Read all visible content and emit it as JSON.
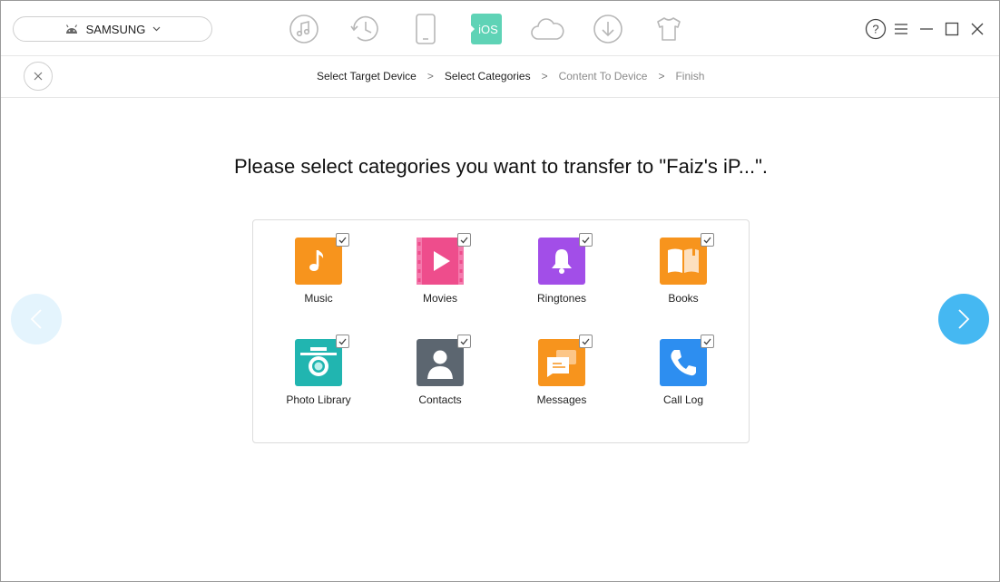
{
  "topbar": {
    "device_name": "SAMSUNG",
    "nav_icons": [
      "music-icon",
      "history-icon",
      "phone-icon",
      "ios-mover-icon",
      "cloud-icon",
      "download-icon",
      "tshirt-icon"
    ],
    "active_icon": "ios-mover-icon",
    "ios_badge": "iOS"
  },
  "breadcrumb": {
    "steps": [
      "Select Target Device",
      "Select Categories",
      "Content To Device",
      "Finish"
    ],
    "separator": ">"
  },
  "main": {
    "headline": "Please select categories you want to transfer to \"Faiz's iP...\"."
  },
  "categories": [
    {
      "label": "Music",
      "icon": "music-note-icon",
      "color": "#f7941d",
      "checked": true
    },
    {
      "label": "Movies",
      "icon": "movie-icon",
      "color": "#ee4d8c",
      "checked": true
    },
    {
      "label": "Ringtones",
      "icon": "bell-icon",
      "color": "#a24ee8",
      "checked": true
    },
    {
      "label": "Books",
      "icon": "book-icon",
      "color": "#f7941d",
      "checked": true
    },
    {
      "label": "Photo Library",
      "icon": "camera-icon",
      "color": "#21b5b0",
      "checked": true
    },
    {
      "label": "Contacts",
      "icon": "contact-icon",
      "color": "#5c6670",
      "checked": true
    },
    {
      "label": "Messages",
      "icon": "message-icon",
      "color": "#f7941d",
      "checked": true
    },
    {
      "label": "Call Log",
      "icon": "phone-call-icon",
      "color": "#2d8ef0",
      "checked": true
    }
  ],
  "colors": {
    "accent": "#45b8f2",
    "accent_light": "#e4f4fd",
    "ios_green": "#5fd3b6"
  }
}
